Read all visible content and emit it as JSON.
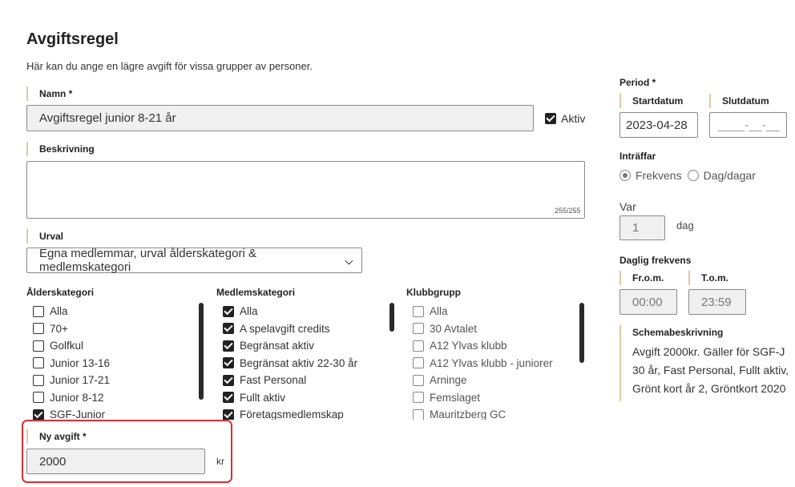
{
  "page": {
    "title": "Avgiftsregel",
    "subtitle": "Här kan du ange en lägre avgift för vissa grupper av personer."
  },
  "name": {
    "label": "Namn *",
    "value": "Avgiftsregel junior 8-21 år",
    "active_label": "Aktiv",
    "active": true
  },
  "description": {
    "label": "Beskrivning",
    "value": "",
    "counter": "255/255"
  },
  "selection": {
    "label": "Urval",
    "value": "Egna medlemmar, urval ålderskategori & medlemskategori"
  },
  "age_category": {
    "label": "Ålderskategori",
    "items": [
      {
        "label": "Alla",
        "checked": false
      },
      {
        "label": "70+",
        "checked": false
      },
      {
        "label": "Golfkul",
        "checked": false
      },
      {
        "label": "Junior 13-16",
        "checked": false
      },
      {
        "label": "Junior 17-21",
        "checked": false
      },
      {
        "label": "Junior 8-12",
        "checked": false
      },
      {
        "label": "SGF-Junior",
        "checked": true
      }
    ]
  },
  "member_category": {
    "label": "Medlemskategori",
    "items": [
      {
        "label": "Alla",
        "checked": true
      },
      {
        "label": "A spelavgift credits",
        "checked": true
      },
      {
        "label": "Begränsat aktiv",
        "checked": true
      },
      {
        "label": "Begränsat aktiv 22-30 år",
        "checked": true
      },
      {
        "label": "Fast Personal",
        "checked": true
      },
      {
        "label": "Fullt aktiv",
        "checked": true
      },
      {
        "label": "Företagsmedlemskap",
        "checked": true
      }
    ]
  },
  "club_group": {
    "label": "Klubbgrupp",
    "items": [
      {
        "label": "Alla",
        "checked": false
      },
      {
        "label": "30 Avtalet",
        "checked": false
      },
      {
        "label": "A12 Ylvas klubb",
        "checked": false
      },
      {
        "label": "A12 Ylvas klubb - juniorer",
        "checked": false
      },
      {
        "label": "Arninge",
        "checked": false
      },
      {
        "label": "Femslaget",
        "checked": false
      },
      {
        "label": "Mauritzberg GC",
        "checked": false
      }
    ]
  },
  "new_fee": {
    "label": "Ny avgift *",
    "value": "2000",
    "unit": "kr"
  },
  "period": {
    "label": "Period *",
    "start_label": "Startdatum",
    "start_value": "2023-04-28",
    "end_label": "Slutdatum",
    "end_placeholder": "____-__-__"
  },
  "occurs": {
    "label": "Inträffar",
    "options": [
      {
        "label": "Frekvens",
        "selected": true
      },
      {
        "label": "Dag/dagar",
        "selected": false
      }
    ]
  },
  "every": {
    "label": "Var",
    "value": "1",
    "unit": "dag"
  },
  "daily": {
    "label": "Daglig frekvens",
    "from_label": "Fr.o.m.",
    "from_value": "00:00",
    "to_label": "T.o.m.",
    "to_value": "23:59"
  },
  "schedule": {
    "label": "Schemabeskrivning",
    "lines": [
      "Avgift 2000kr. Gäller för SGF-J",
      "30 år, Fast Personal, Fullt aktiv,",
      "Grönt kort år 2, Gröntkort 2020"
    ]
  }
}
